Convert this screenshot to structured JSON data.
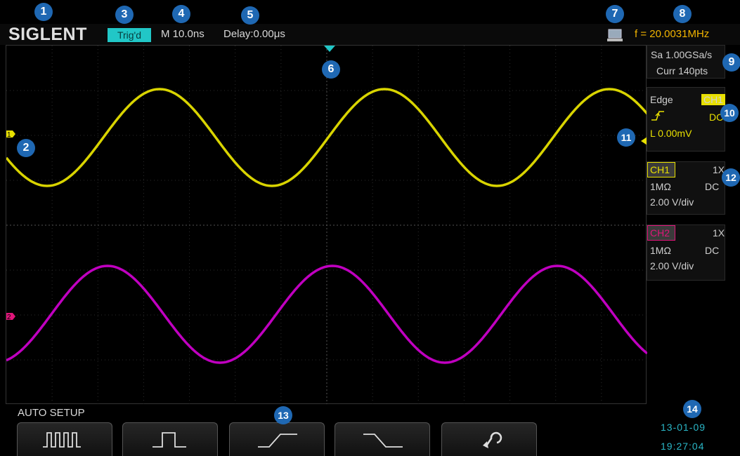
{
  "brand": "SIGLENT",
  "status": {
    "trigger_state": "Trig'd",
    "timebase": "M 10.0ns",
    "delay": "Delay:0.00μs",
    "frequency": "f = 20.0031MHz"
  },
  "acquisition": {
    "sample_rate": "Sa 1.00GSa/s",
    "current_points": "Curr 140pts"
  },
  "trigger": {
    "type": "Edge",
    "source": "CH1",
    "coupling": "DC",
    "level": "L  0.00mV"
  },
  "channels": [
    {
      "name": "CH1",
      "probe": "1X",
      "impedance": "1MΩ",
      "coupling": "DC",
      "scale": "2.00 V/div",
      "color": "#e8e000"
    },
    {
      "name": "CH2",
      "probe": "1X",
      "impedance": "1MΩ",
      "coupling": "DC",
      "scale": "2.00 V/div",
      "color": "#e0157a"
    }
  ],
  "channel_markers": {
    "ch1": "1",
    "ch2": "2"
  },
  "waveforms": {
    "ch1_color": "#d9d400",
    "ch2_color": "#c000c0"
  },
  "menu": {
    "title": "AUTO SETUP",
    "softkeys": [
      {
        "icon": "multi-period-icon"
      },
      {
        "icon": "single-period-icon"
      },
      {
        "icon": "rising-edge-icon"
      },
      {
        "icon": "falling-edge-icon"
      },
      {
        "icon": "undo-icon"
      }
    ]
  },
  "datetime": {
    "date": "13-01-09",
    "time": "19:27:04"
  },
  "callouts": [
    "1",
    "2",
    "3",
    "4",
    "5",
    "6",
    "7",
    "8",
    "9",
    "10",
    "11",
    "12",
    "13",
    "14"
  ],
  "colors": {
    "trigger_badge": "#21c7c7",
    "frequency": "#f2b400",
    "clock": "#2ab7c7",
    "callout": "#1f68b3"
  }
}
